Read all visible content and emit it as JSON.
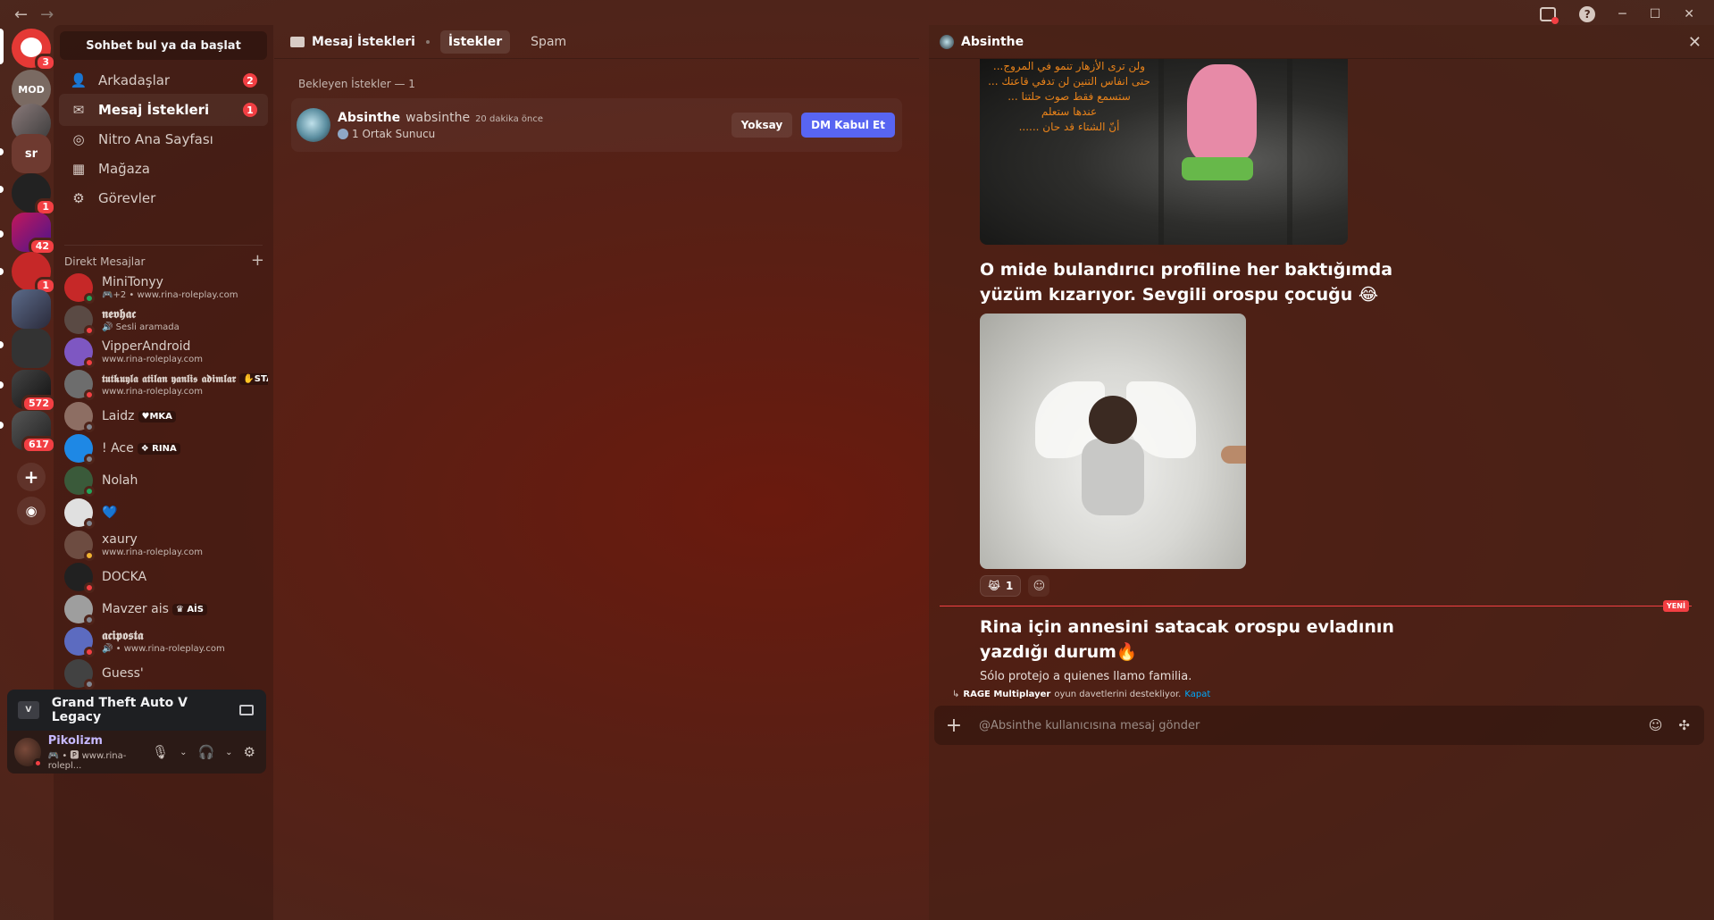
{
  "titlebar": {
    "back": "←",
    "forward": "→",
    "help": "?",
    "minimize": "─",
    "maximize": "☐",
    "close": "✕"
  },
  "rail": {
    "badges": {
      "home": "3",
      "s5": "1",
      "s6": "42",
      "s7": "1",
      "s10": "572",
      "s11": "617"
    },
    "sr_label": "sr",
    "mod_label": "MOD"
  },
  "sidebar": {
    "search_label": "Sohbet bul ya da başlat",
    "nav": [
      {
        "label": "Arkadaşlar",
        "badge": "2",
        "icon": "friends-icon"
      },
      {
        "label": "Mesaj İstekleri",
        "badge": "1",
        "icon": "mail-icon"
      },
      {
        "label": "Nitro Ana Sayfası",
        "badge": "",
        "icon": "nitro-icon"
      },
      {
        "label": "Mağaza",
        "badge": "",
        "icon": "shop-icon"
      },
      {
        "label": "Görevler",
        "badge": "",
        "icon": "quests-icon"
      }
    ],
    "dm_header": "Direkt Mesajlar",
    "dm_add": "+",
    "dms": [
      {
        "name": "MiniTonyy",
        "sub": "🎮+2 • www.rina-roleplay.com",
        "tag": "",
        "status": "online"
      },
      {
        "name": "𝖓𝖊𝖛𝖍𝖆𝖈",
        "sub": "🔊 Sesli aramada",
        "tag": "",
        "status": "dnd"
      },
      {
        "name": "VipperAndroid",
        "sub": "www.rina-roleplay.com",
        "tag": "",
        "status": "dnd"
      },
      {
        "name": "𝖙𝖚𝖙𝖐𝖚𝖞𝖑𝖆 𝖆𝖙𝖎𝖑𝖆𝖓 𝖞𝖆𝖓𝖑𝖎𝖘 𝖆𝖉𝖎𝖒𝖑𝖆𝖗",
        "sub": "www.rina-roleplay.com",
        "tag": "✋STA",
        "status": "dnd"
      },
      {
        "name": "Laidz",
        "sub": "",
        "tag": "♥MKA",
        "status": "offline"
      },
      {
        "name": "! Ace",
        "sub": "",
        "tag": "❖ RINA",
        "status": "offline"
      },
      {
        "name": "Nolah",
        "sub": "",
        "tag": "",
        "status": "online"
      },
      {
        "name": "💙",
        "sub": "",
        "tag": "",
        "status": "offline"
      },
      {
        "name": "xaury",
        "sub": "www.rina-roleplay.com",
        "tag": "",
        "status": "idle"
      },
      {
        "name": "DOCKA",
        "sub": "",
        "tag": "",
        "status": "dnd"
      },
      {
        "name": "Mavzer ais",
        "sub": "",
        "tag": "♛ AİS",
        "status": "offline"
      },
      {
        "name": "𝖆𝖈𝖎𝖕𝖔𝖘𝖙𝖆",
        "sub": "🔊 • www.rina-roleplay.com",
        "tag": "",
        "status": "dnd"
      },
      {
        "name": "Guess'",
        "sub": "",
        "tag": "",
        "status": "offline"
      }
    ],
    "activity": {
      "game": "Grand Theft Auto V Legacy",
      "icon_text": "V"
    },
    "user": {
      "name": "Pikolizm",
      "status": "🎮 • 🅿 www.rina-rolepl..."
    }
  },
  "middle": {
    "header_title": "Mesaj İstekleri",
    "tabs": [
      "İstekler",
      "Spam"
    ],
    "pending_label": "Bekleyen İstekler — 1",
    "request": {
      "name": "Absinthe",
      "username": "wabsinthe",
      "time": "20 dakika önce",
      "mutual": "1 Ortak Sunucu",
      "ignore_label": "Yoksay",
      "accept_label": "DM Kabul Et"
    }
  },
  "right": {
    "header_name": "Absinthe",
    "close": "✕",
    "meme_arabic": [
      "ولن ترى الأزهار تنمو في المروج...",
      "حتى انفاس التنين لن تدفي قاعتك ...",
      "ستسمع فقط صوت حلتنا ...",
      "عندها ستعلم",
      "أنّ الشتاء قد حان ......"
    ],
    "message1": "O mide bulandırıcı profiline her baktığımda yüzüm kızarıyor. Sevgili orospu çocuğu 😂",
    "reaction_emoji": "😹",
    "reaction_count": "1",
    "new_label": "YENİ",
    "message2": "Rina için annesini satacak orospu evladının yazdığı durum🔥",
    "message3": "Sólo protejo a quienes llamo familia.",
    "notice": {
      "bold": "RAGE Multiplayer",
      "text": " oyun davetlerini destekliyor.",
      "link": "Kapat"
    },
    "composer_placeholder": "@Absinthe kullanıcısına mesaj gönder"
  },
  "colors": {
    "accent": "#5865f2",
    "danger": "#f23f43",
    "bg": "#5a1f14"
  }
}
